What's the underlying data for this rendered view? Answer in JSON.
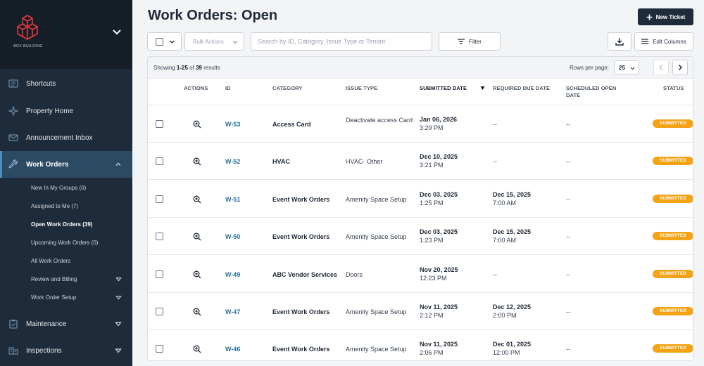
{
  "sidebar": {
    "brand": "BOX BUILDING",
    "nav": [
      {
        "label": "Shortcuts",
        "icon": "shortcuts-icon"
      },
      {
        "label": "Property Home",
        "icon": "property-home-icon"
      },
      {
        "label": "Announcement Inbox",
        "icon": "mail-icon"
      },
      {
        "label": "Work Orders",
        "icon": "wrench-icon"
      },
      {
        "label": "Maintenance",
        "icon": "clipboard-icon"
      },
      {
        "label": "Inspections",
        "icon": "inspections-icon"
      }
    ],
    "work_order_sub": [
      {
        "label": "New In My Groups (0)"
      },
      {
        "label": "Assigned to Me (7)"
      },
      {
        "label": "Open Work Orders (39)"
      },
      {
        "label": "Upcoming Work Orders (0)"
      },
      {
        "label": "All Work Orders"
      },
      {
        "label": "Review and Billing"
      },
      {
        "label": "Work Order Setup"
      }
    ]
  },
  "header": {
    "title": "Work Orders: Open",
    "new_ticket": "New Ticket"
  },
  "toolbar": {
    "bulk_actions": "Bulk Actions",
    "search_placeholder": "Search by ID, Category, Issue Type or Tenant",
    "filter": "Filter",
    "edit_columns": "Edit Columns"
  },
  "pagination": {
    "showing_prefix": "Showing ",
    "range": "1-25",
    "of": " of ",
    "total": "39",
    "suffix": " results",
    "rows_per_page_label": "Rows per page:",
    "rows_per_page": "25"
  },
  "table": {
    "columns": [
      "ACTIONS",
      "ID",
      "CATEGORY",
      "ISSUE TYPE",
      "SUBMITTED DATE",
      "REQUIRED DUE DATE",
      "SCHEDULED OPEN DATE",
      "STATUS"
    ],
    "rows": [
      {
        "id": "W-53",
        "category": "Access Card",
        "issue": "Deactivate access Card",
        "sub_date": "Jan 06, 2026",
        "sub_time": "3:29 PM",
        "due_date": "--",
        "due_time": "",
        "sched": "--",
        "status": "SUBMITTED"
      },
      {
        "id": "W-52",
        "category": "HVAC",
        "issue": "HVAC- Other",
        "sub_date": "Dec 10, 2025",
        "sub_time": "3:21 PM",
        "due_date": "--",
        "due_time": "",
        "sched": "--",
        "status": "SUBMITTED"
      },
      {
        "id": "W-51",
        "category": "Event Work Orders",
        "issue": "Amenity Space Setup",
        "sub_date": "Dec 03, 2025",
        "sub_time": "1:25 PM",
        "due_date": "Dec 15, 2025",
        "due_time": "7:00 AM",
        "sched": "--",
        "status": "SUBMITTED"
      },
      {
        "id": "W-50",
        "category": "Event Work Orders",
        "issue": "Amenity Space Setup",
        "sub_date": "Dec 03, 2025",
        "sub_time": "1:23 PM",
        "due_date": "Dec 15, 2025",
        "due_time": "7:00 AM",
        "sched": "--",
        "status": "SUBMITTED"
      },
      {
        "id": "W-49",
        "category": "ABC Vendor Services",
        "issue": "Doors",
        "sub_date": "Nov 20, 2025",
        "sub_time": "12:23 PM",
        "due_date": "--",
        "due_time": "",
        "sched": "--",
        "status": "SUBMITTED"
      },
      {
        "id": "W-47",
        "category": "Event Work Orders",
        "issue": "Amenity Space Setup",
        "sub_date": "Nov 11, 2025",
        "sub_time": "2:12 PM",
        "due_date": "Dec 12, 2025",
        "due_time": "2:00 PM",
        "sched": "--",
        "status": "SUBMITTED"
      },
      {
        "id": "W-46",
        "category": "Event Work Orders",
        "issue": "Amenity Space Setup",
        "sub_date": "Nov 11, 2025",
        "sub_time": "2:06 PM",
        "due_date": "Dec 01, 2025",
        "due_time": "12:00 PM",
        "sched": "--",
        "status": "SUBMITTED"
      }
    ]
  },
  "colors": {
    "sidebar_bg": "#1e2b3a",
    "brand_red": "#e0393e",
    "link": "#2b6f96",
    "badge": "#f4a316"
  }
}
